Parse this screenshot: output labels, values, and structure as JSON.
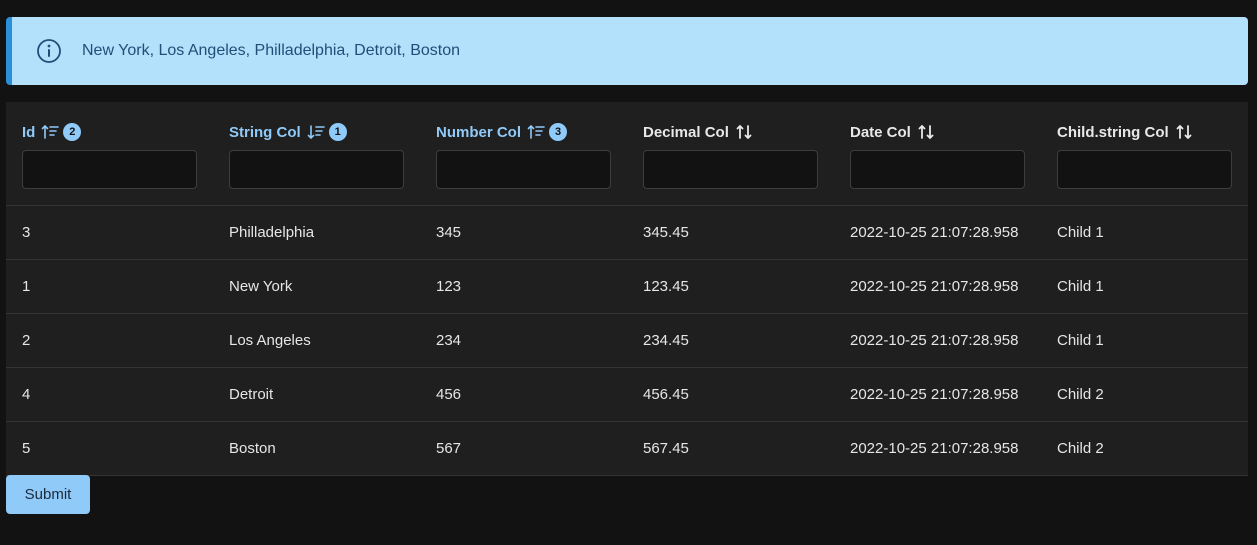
{
  "alert": {
    "text": "New York, Los Angeles, Philladelphia, Detroit, Boston",
    "icon": "info-icon"
  },
  "columns": [
    {
      "label": "Id",
      "sorted": true,
      "direction": "asc",
      "order": "2"
    },
    {
      "label": "String Col",
      "sorted": true,
      "direction": "desc",
      "order": "1"
    },
    {
      "label": "Number Col",
      "sorted": true,
      "direction": "asc",
      "order": "3"
    },
    {
      "label": "Decimal Col",
      "sorted": false,
      "direction": "none",
      "order": ""
    },
    {
      "label": "Date Col",
      "sorted": false,
      "direction": "none",
      "order": ""
    },
    {
      "label": "Child.string Col",
      "sorted": false,
      "direction": "none",
      "order": ""
    }
  ],
  "rows": [
    [
      "3",
      "Philladelphia",
      "345",
      "345.45",
      "2022-10-25 21:07:28.958",
      "Child 1"
    ],
    [
      "1",
      "New York",
      "123",
      "123.45",
      "2022-10-25 21:07:28.958",
      "Child 1"
    ],
    [
      "2",
      "Los Angeles",
      "234",
      "234.45",
      "2022-10-25 21:07:28.958",
      "Child 1"
    ],
    [
      "4",
      "Detroit",
      "456",
      "456.45",
      "2022-10-25 21:07:28.958",
      "Child 2"
    ],
    [
      "5",
      "Boston",
      "567",
      "567.45",
      "2022-10-25 21:07:28.958",
      "Child 2"
    ]
  ],
  "submit_label": "Submit",
  "colors": {
    "accent": "#90caf9",
    "alert_bg": "#b3e0fb",
    "alert_border": "#2a8fd8",
    "bg": "#121212",
    "table_bg": "#1f1f1f"
  }
}
